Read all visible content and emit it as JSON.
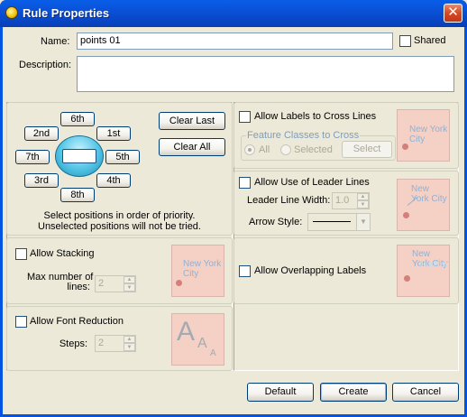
{
  "window": {
    "title": "Rule Properties",
    "close_glyph": "✕"
  },
  "general": {
    "name_label": "Name:",
    "name_value": "points 01",
    "shared_label": "Shared",
    "description_label": "Description:",
    "description_value": ""
  },
  "positions": {
    "buttons": [
      "6th",
      "2nd",
      "1st",
      "7th",
      "5th",
      "3rd",
      "4th",
      "8th"
    ],
    "clear_last": "Clear Last",
    "clear_all": "Clear All",
    "hint_line1": "Select positions in order of priority.",
    "hint_line2": "Unselected positions will not be tried."
  },
  "stacking": {
    "allow_label": "Allow Stacking",
    "max_label_line1": "Max number of",
    "max_label_line2": "lines:",
    "max_value": "2",
    "preview_text": "New York City"
  },
  "font_reduction": {
    "allow_label": "Allow Font Reduction",
    "steps_label": "Steps:",
    "steps_value": "2",
    "preview_big": "A",
    "preview_mid": "A",
    "preview_small": "A"
  },
  "cross_lines": {
    "allow_label": "Allow Labels to Cross Lines",
    "group_label": "Feature Classes to Cross",
    "all_label": "All",
    "selected_label": "Selected",
    "select_button": "Select",
    "preview_text": "New York City"
  },
  "leader_lines": {
    "allow_label": "Allow Use of Leader Lines",
    "width_label": "Leader Line Width:",
    "width_value": "1.0",
    "arrow_label": "Arrow Style:",
    "preview_text": "New York City"
  },
  "overlapping": {
    "allow_label": "Allow Overlapping Labels",
    "preview_text": "New York City",
    "preview_overlap": "Hudson"
  },
  "footer": {
    "default": "Default",
    "create": "Create",
    "cancel": "Cancel"
  },
  "colors": {
    "titlebar": "#0054e3",
    "dialog_bg": "#ece9d8",
    "preview_bg": "#f5d0c5",
    "preview_text": "#8fb2d6"
  }
}
